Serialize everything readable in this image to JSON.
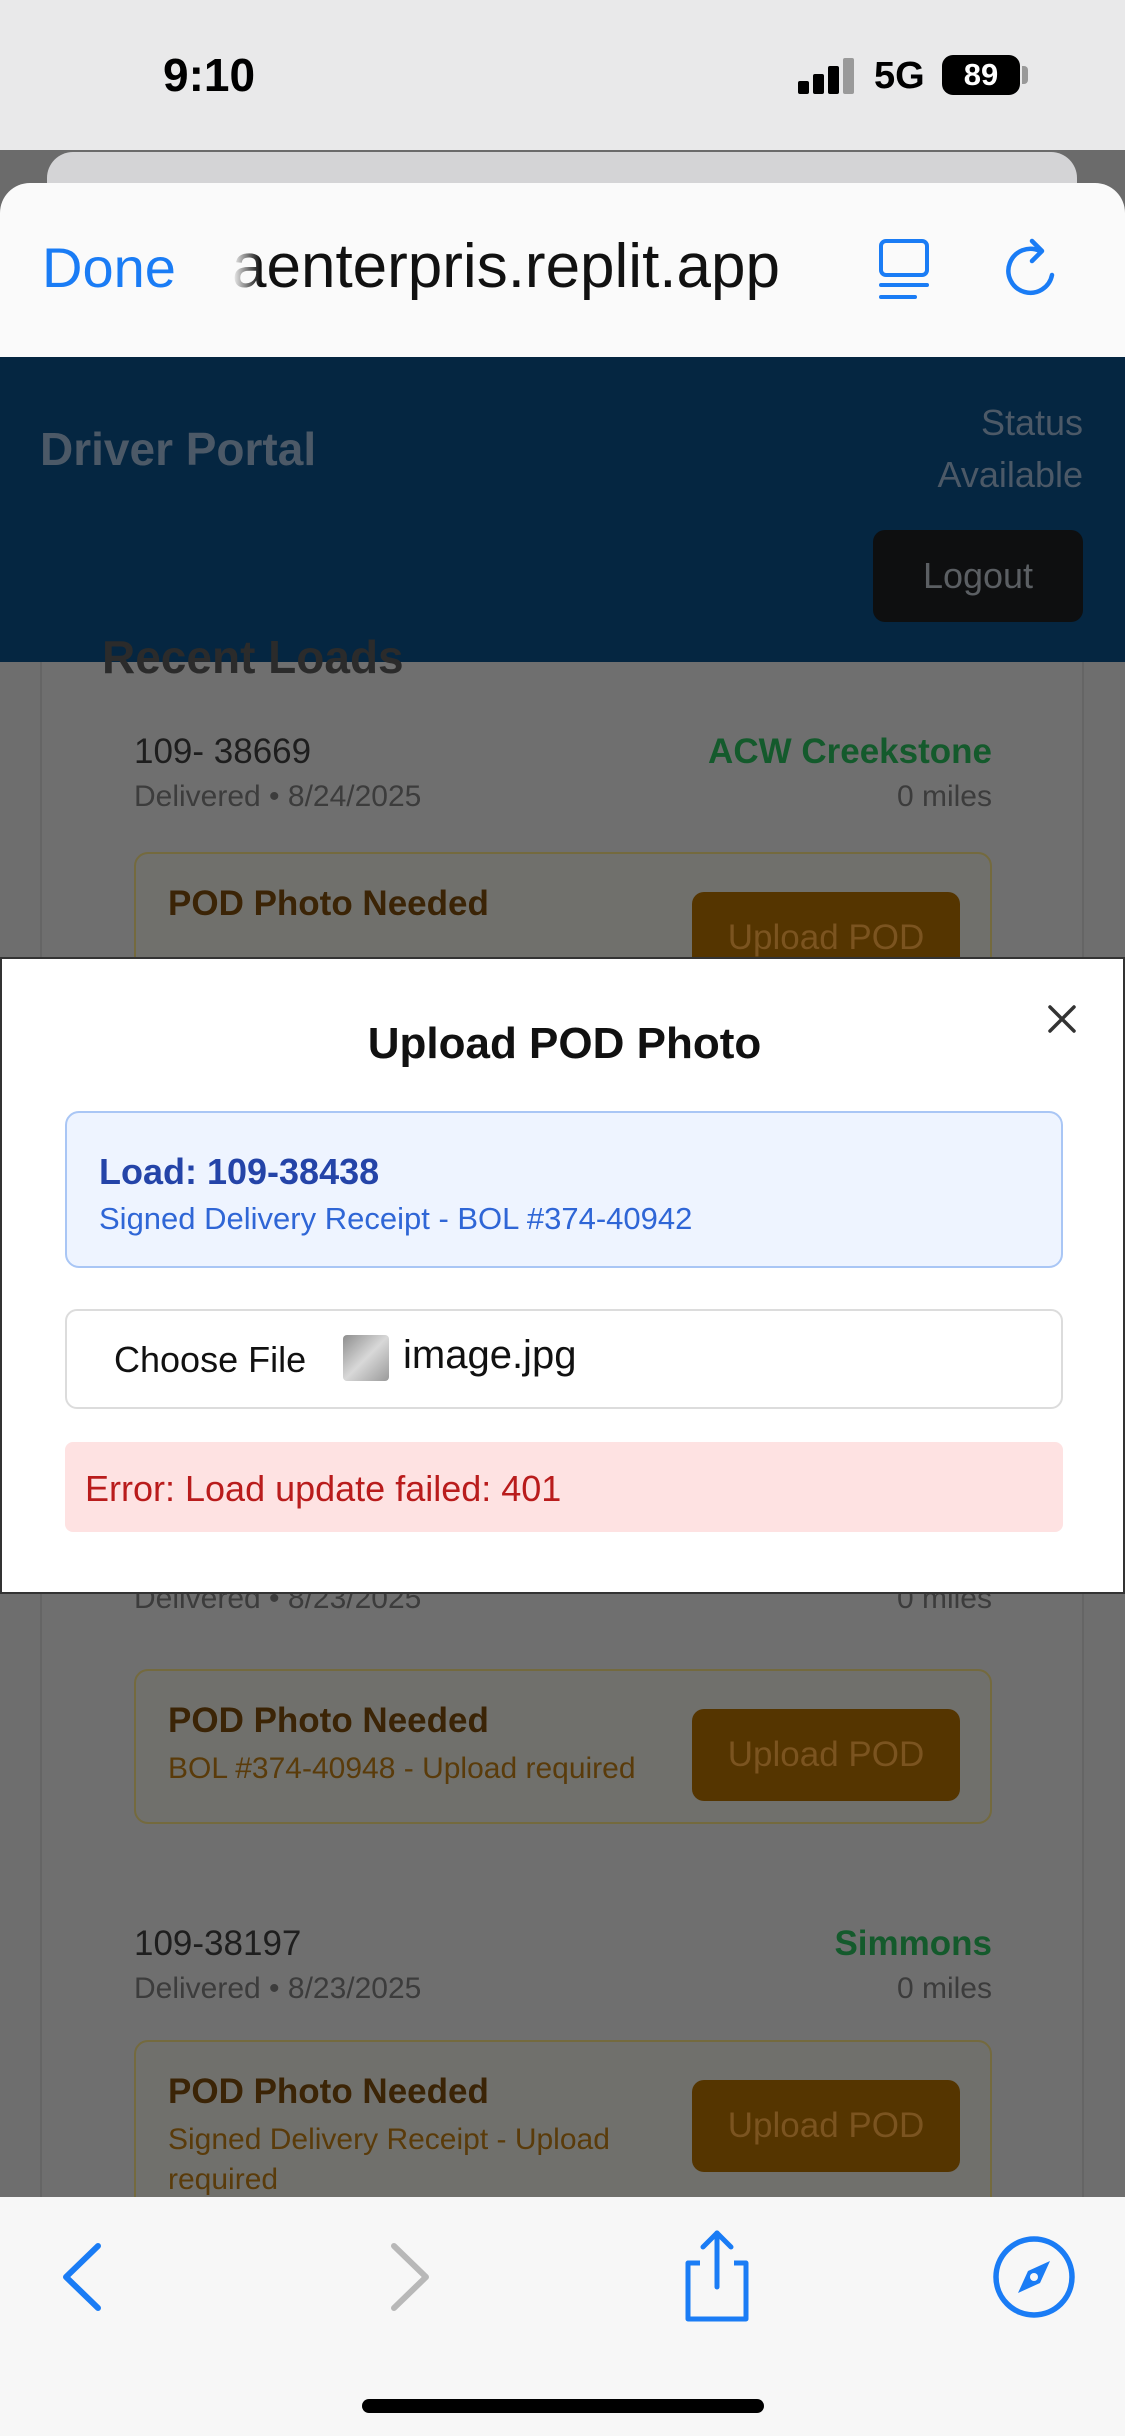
{
  "status_bar": {
    "time": "9:10",
    "network": "5G",
    "battery": "89"
  },
  "browser": {
    "done_label": "Done",
    "url": "aenterpris.replit.app",
    "reader_icon": "reader-icon",
    "reload_icon": "reload-icon"
  },
  "app": {
    "title": "Driver Portal",
    "status_label": "Status",
    "status_value": "Available",
    "logout_label": "Logout",
    "recent_heading": "Recent Loads",
    "loads": [
      {
        "number": "109- 38669",
        "sub": "Delivered • 8/24/2025",
        "customer": "ACW Creekstone",
        "miles": "0 miles",
        "pod_title": "POD Photo Needed",
        "pod_detail": "",
        "upload_label": "Upload POD"
      },
      {
        "number": "",
        "sub": "Delivered • 8/23/2025",
        "customer": "",
        "miles": "0 miles",
        "pod_title": "POD Photo Needed",
        "pod_detail": "BOL #374-40948 - Upload required",
        "upload_label": "Upload POD"
      },
      {
        "number": "109-38197",
        "sub": "Delivered • 8/23/2025",
        "customer": "Simmons",
        "miles": "0 miles",
        "pod_title": "POD Photo Needed",
        "pod_detail": "Signed Delivery Receipt - Upload required",
        "upload_label": "Upload POD"
      }
    ]
  },
  "modal": {
    "title": "Upload POD Photo",
    "close_icon": "close-icon",
    "load_label": "Load: 109-38438",
    "load_desc": "Signed Delivery Receipt - BOL #374-40942",
    "choose_file_label": "Choose File",
    "file_name": "image.jpg",
    "error": "Error: Load update failed: 401"
  },
  "toolbar": {
    "back_icon": "back-icon",
    "forward_icon": "forward-icon",
    "share_icon": "share-icon",
    "safari_icon": "compass-icon"
  },
  "colors": {
    "accent": "#1a7cf5",
    "header_bg": "#052641",
    "error_bg": "#fee2e2",
    "error_text": "#b91c1c",
    "info_bg": "#eef4ff"
  }
}
